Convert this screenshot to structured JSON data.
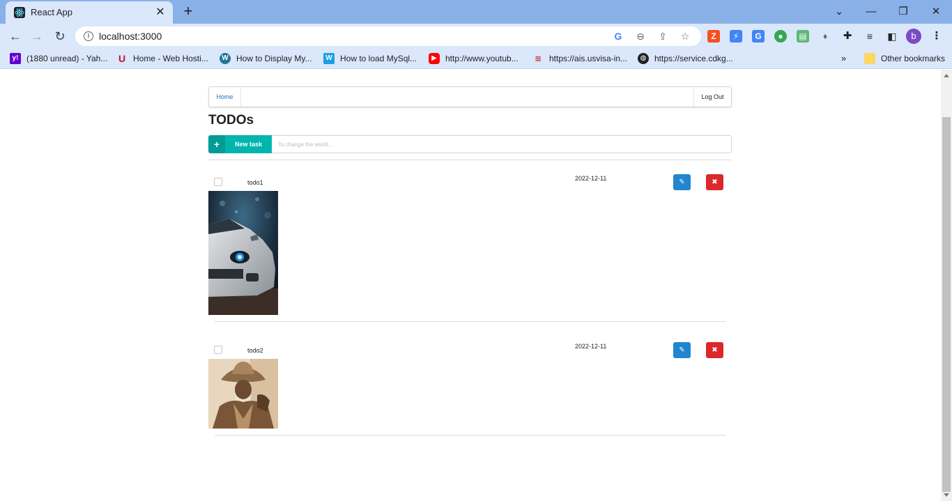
{
  "browser": {
    "tab_title": "React App",
    "url": "localhost:3000",
    "profile_initial": "b",
    "bookmarks": [
      {
        "label": "(1880 unread) - Yah...",
        "icon": "yahoo-mail-icon",
        "color": "#6001d2"
      },
      {
        "label": "Home - Web Hosti...",
        "icon": "hosting-u-icon",
        "color": "#c8102e"
      },
      {
        "label": "How to Display My...",
        "icon": "wordpress-icon",
        "color": "#21759b"
      },
      {
        "label": "How to load MySql...",
        "icon": "w-icon",
        "color": "#1ba1e2"
      },
      {
        "label": "http://www.youtub...",
        "icon": "youtube-icon",
        "color": "#ff0000"
      },
      {
        "label": "https://ais.usvisa-in...",
        "icon": "usvisa-icon",
        "color": "#d32f2f"
      },
      {
        "label": "https://service.cdkg...",
        "icon": "globe-icon",
        "color": "#202124"
      }
    ],
    "other_bookmarks": "Other bookmarks"
  },
  "nav": {
    "home_label": "Home",
    "logout_label": "Log Out"
  },
  "page": {
    "title": "TODOs"
  },
  "new_task": {
    "button_label": "New task",
    "placeholder": "To change the world..."
  },
  "todos": [
    {
      "name": "todo1",
      "date": "2022-12-11",
      "checked": false,
      "image": "car-photo"
    },
    {
      "name": "todo2",
      "date": "2022-12-11",
      "checked": false,
      "image": "cowboy-photo"
    }
  ],
  "colors": {
    "primary": "#2185d0",
    "danger": "#db2828",
    "teal": "#00b5ad",
    "link": "#1e70bf"
  }
}
